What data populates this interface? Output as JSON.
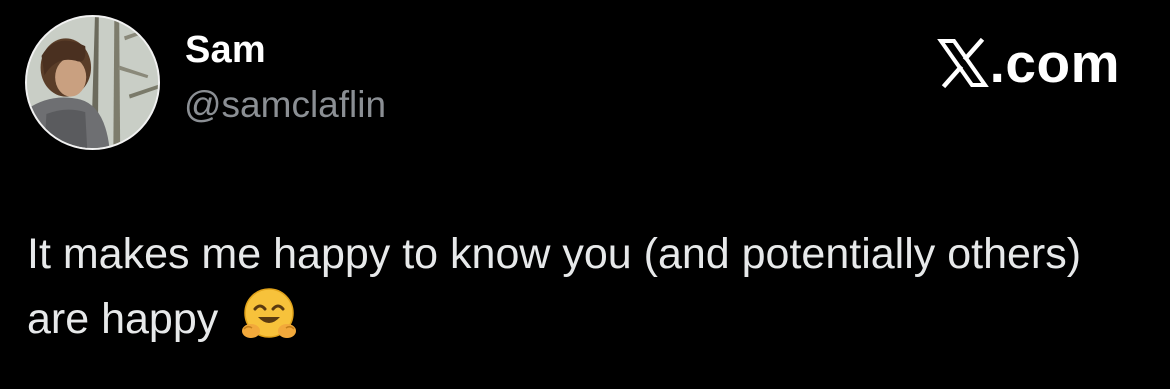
{
  "author": {
    "display_name": "Sam",
    "handle": "@samclaflin",
    "avatar_icon": "profile-photo"
  },
  "brand": {
    "label": ".com",
    "logo_icon": "x-logo-icon"
  },
  "tweet": {
    "text": "It makes me happy to know you (and potentially others) are happy",
    "emoji_icon": "hugging-face-emoji-icon"
  },
  "colors": {
    "background": "#000000",
    "primary_text": "#e7e9ea",
    "secondary_text": "#8b8f94"
  }
}
